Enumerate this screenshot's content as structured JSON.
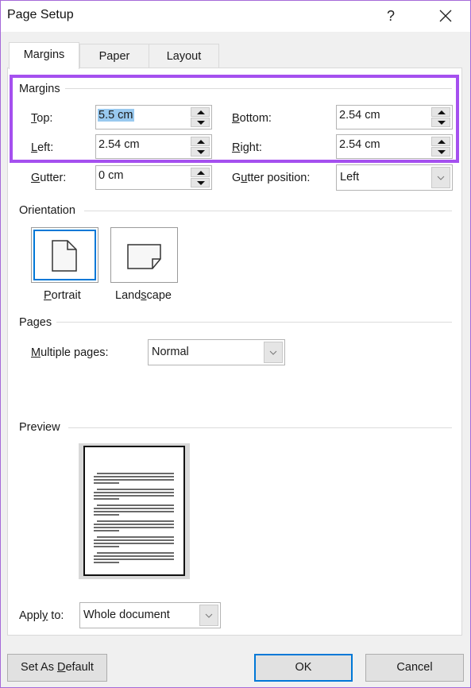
{
  "window": {
    "title": "Page Setup",
    "help_label": "?",
    "close_icon": "close-icon"
  },
  "tabs": [
    {
      "label": "Margins",
      "active": true
    },
    {
      "label": "Paper",
      "active": false
    },
    {
      "label": "Layout",
      "active": false
    }
  ],
  "margins": {
    "group_label": "Margins",
    "top": {
      "label_u": "T",
      "label_rest": "op:",
      "value": "5.5 cm"
    },
    "bottom": {
      "label_u": "B",
      "label_rest": "ottom:",
      "value": "2.54 cm"
    },
    "left": {
      "label_u": "L",
      "label_rest": "eft:",
      "value": "2.54 cm"
    },
    "right": {
      "label_u": "R",
      "label_rest": "ight:",
      "value": "2.54 cm"
    },
    "gutter": {
      "label_u": "G",
      "label_rest": "utter:",
      "value": "0 cm"
    },
    "gutter_position": {
      "label_pre": "G",
      "label_u": "u",
      "label_rest": "tter position:",
      "value": "Left"
    }
  },
  "orientation": {
    "group_label": "Orientation",
    "portrait": {
      "label_u": "P",
      "label_rest": "ortrait",
      "selected": true
    },
    "landscape": {
      "label_pre": "Land",
      "label_u": "s",
      "label_rest": "cape",
      "selected": false
    }
  },
  "pages": {
    "group_label": "Pages",
    "multiple_pages": {
      "label_u": "M",
      "label_rest": "ultiple pages:",
      "value": "Normal"
    }
  },
  "preview": {
    "group_label": "Preview"
  },
  "apply_to": {
    "label_pre": "Appl",
    "label_u": "y",
    "label_rest": " to:",
    "value": "Whole document"
  },
  "buttons": {
    "set_default_pre": "Set As ",
    "set_default_u": "D",
    "set_default_rest": "efault",
    "ok": "OK",
    "cancel": "Cancel"
  },
  "colors": {
    "highlight": "#a550ef",
    "focus": "#0078d7",
    "selection": "#99c9ef"
  }
}
